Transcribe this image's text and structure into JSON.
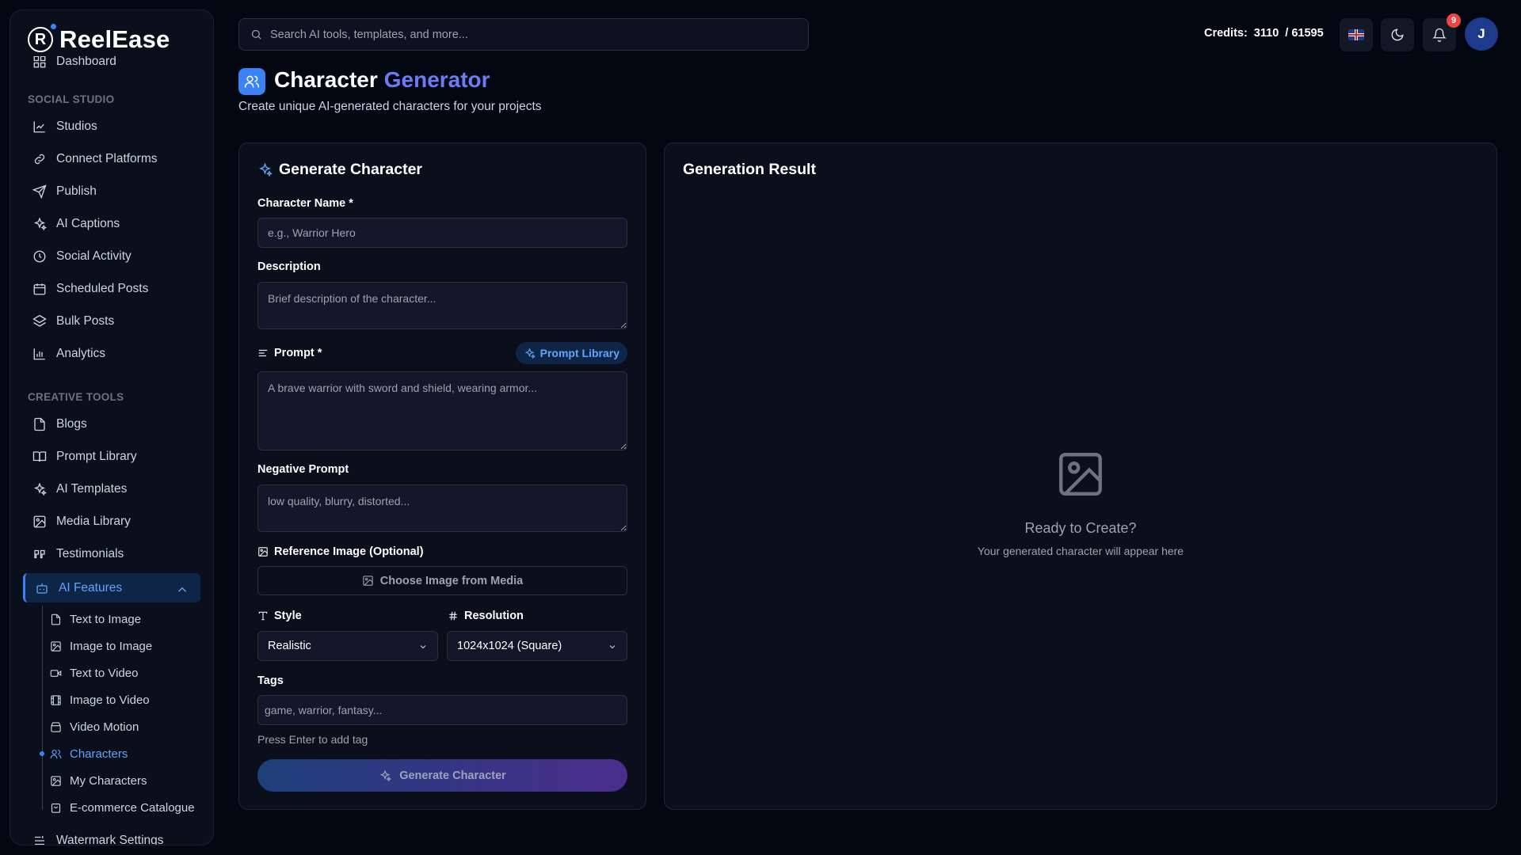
{
  "app": {
    "name": "ReelEase",
    "logo_letter": "R"
  },
  "sidebar": {
    "top_item": "Dashboard",
    "sections": [
      {
        "title": "SOCIAL STUDIO",
        "items": [
          "Studios",
          "Connect Platforms",
          "Publish",
          "AI Captions",
          "Social Activity",
          "Scheduled Posts",
          "Bulk Posts",
          "Analytics"
        ]
      },
      {
        "title": "CREATIVE TOOLS",
        "items": [
          "Blogs",
          "Prompt Library",
          "AI Templates",
          "Media Library",
          "Testimonials"
        ]
      }
    ],
    "ai_features": {
      "label": "AI Features",
      "sub_items": [
        "Text to Image",
        "Image to Image",
        "Text to Video",
        "Image to Video",
        "Video Motion",
        "Characters",
        "My Characters",
        "E-commerce Catalogue"
      ],
      "active": "Characters"
    },
    "bottom_item": "Watermark Settings"
  },
  "topbar": {
    "search_placeholder": "Search AI tools, templates, and more...",
    "credits_label": "Credits:",
    "credits_used": "3110",
    "credits_total": "/ 61595",
    "notification_count": "9",
    "avatar_initial": "J"
  },
  "page": {
    "title_main": "Character",
    "title_accent": "Generator",
    "subtitle": "Create unique AI-generated characters for your projects"
  },
  "form": {
    "title": "Generate Character",
    "name_label": "Character Name *",
    "name_placeholder": "e.g., Warrior Hero",
    "description_label": "Description",
    "description_placeholder": "Brief description of the character...",
    "prompt_label": "Prompt *",
    "prompt_library_label": "Prompt Library",
    "prompt_placeholder": "A brave warrior with sword and shield, wearing armor...",
    "negative_label": "Negative Prompt",
    "negative_placeholder": "low quality, blurry, distorted...",
    "reference_label": "Reference Image (Optional)",
    "choose_image_label": "Choose Image from Media",
    "style_label": "Style",
    "style_value": "Realistic",
    "resolution_label": "Resolution",
    "resolution_value": "1024x1024 (Square)",
    "tags_label": "Tags",
    "tags_placeholder": "game, warrior, fantasy...",
    "tags_hint": "Press Enter to add tag",
    "generate_label": "Generate Character"
  },
  "result": {
    "title": "Generation Result",
    "empty_title": "Ready to Create?",
    "empty_subtitle": "Your generated character will appear here"
  },
  "colors": {
    "accent": "#3b82f6",
    "background": "#030712",
    "badge": "#ef4444"
  }
}
